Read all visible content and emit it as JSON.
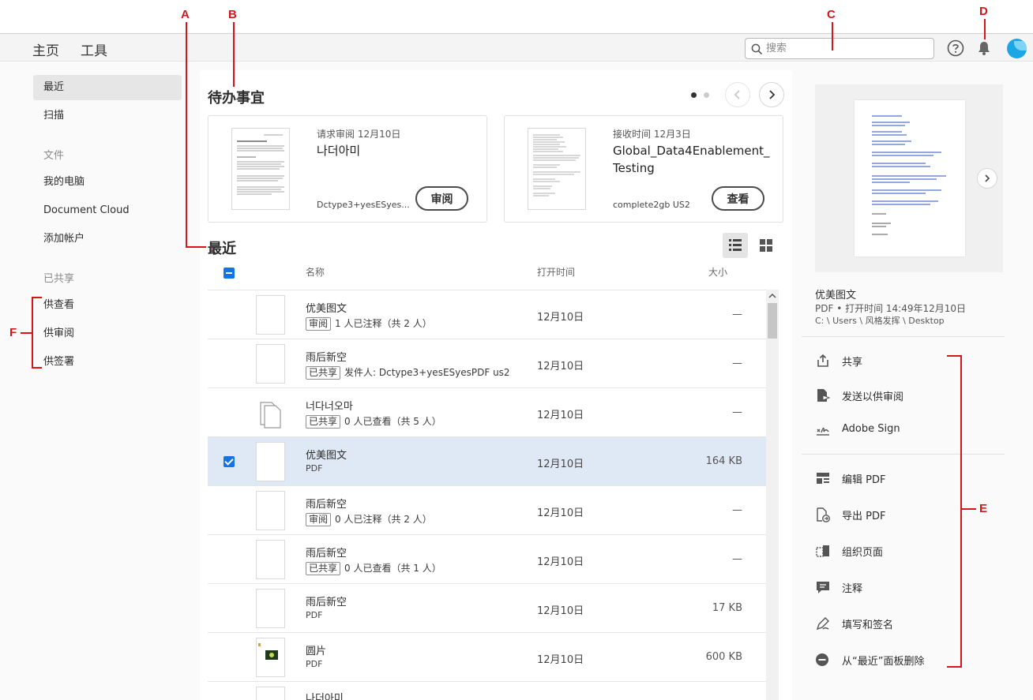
{
  "annotations": {
    "a": "A",
    "b": "B",
    "c": "C",
    "d": "D",
    "e": "E",
    "f": "F"
  },
  "topnav": {
    "home": "主页",
    "tools": "工具"
  },
  "search": {
    "placeholder": "搜索"
  },
  "sidebar": {
    "items": [
      "最近",
      "扫描"
    ],
    "files_heading": "文件",
    "files": [
      "我的电脑",
      "Document Cloud",
      "添加帐户"
    ],
    "shared_heading": "已共享",
    "shared": [
      "供查看",
      "供审阅",
      "供签署"
    ]
  },
  "todo": {
    "title": "待办事宜",
    "cards": [
      {
        "meta": "请求审阅 12月10日",
        "name": "나더아미",
        "sub": "Dctype3+yesESyes...",
        "button": "审阅"
      },
      {
        "meta": "接收时间 12月3日",
        "name": "Global_Data4Enablement_Testing",
        "sub": "complete2gb US2",
        "button": "查看"
      }
    ]
  },
  "recent": {
    "title": "最近",
    "columns": {
      "name": "名称",
      "opened": "打开时间",
      "size": "大小"
    },
    "rows": [
      {
        "name": "优美图文",
        "tag": "审阅",
        "detail": "1 人已注释（共 2 人）",
        "time": "12月10日",
        "size": "—"
      },
      {
        "name": "雨后新空",
        "tag": "已共享",
        "detail": "发件人: Dctype3+yesESyesPDF us2",
        "time": "12月10日",
        "size": "—"
      },
      {
        "name": "너다너오마",
        "tag": "已共享",
        "detail": "0 人已查看（共 5 人）",
        "time": "12月10日",
        "size": "—"
      },
      {
        "name": "优美图文",
        "tag": "",
        "detail": "PDF",
        "time": "12月10日",
        "size": "164 KB"
      },
      {
        "name": "雨后新空",
        "tag": "审阅",
        "detail": "0 人已注释（共 2 人）",
        "time": "12月10日",
        "size": "—"
      },
      {
        "name": "雨后新空",
        "tag": "已共享",
        "detail": "0 人已查看（共 1 人）",
        "time": "12月10日",
        "size": "—"
      },
      {
        "name": "雨后新空",
        "tag": "",
        "detail": "PDF",
        "time": "12月10日",
        "size": "17 KB"
      },
      {
        "name": "圆片",
        "tag": "",
        "detail": "PDF",
        "time": "12月10日",
        "size": "600 KB"
      },
      {
        "name": "나더아미",
        "tag": "",
        "detail": "",
        "time": "",
        "size": ""
      }
    ]
  },
  "details": {
    "title": "优美图文",
    "meta": "PDF • 打开时间 14:49年12月10日",
    "path": "C: \\ Users \\ 风格发挥 \\ Desktop",
    "actions": [
      "共享",
      "发送以供审阅",
      "Adobe Sign",
      "编辑 PDF",
      "导出 PDF",
      "组织页面",
      "注释",
      "填写和签名",
      "从“最近”面板删除"
    ]
  },
  "colors": {
    "accent": "#1473e6",
    "annotation": "#d7141a",
    "selected_row": "#dfe9f5"
  }
}
